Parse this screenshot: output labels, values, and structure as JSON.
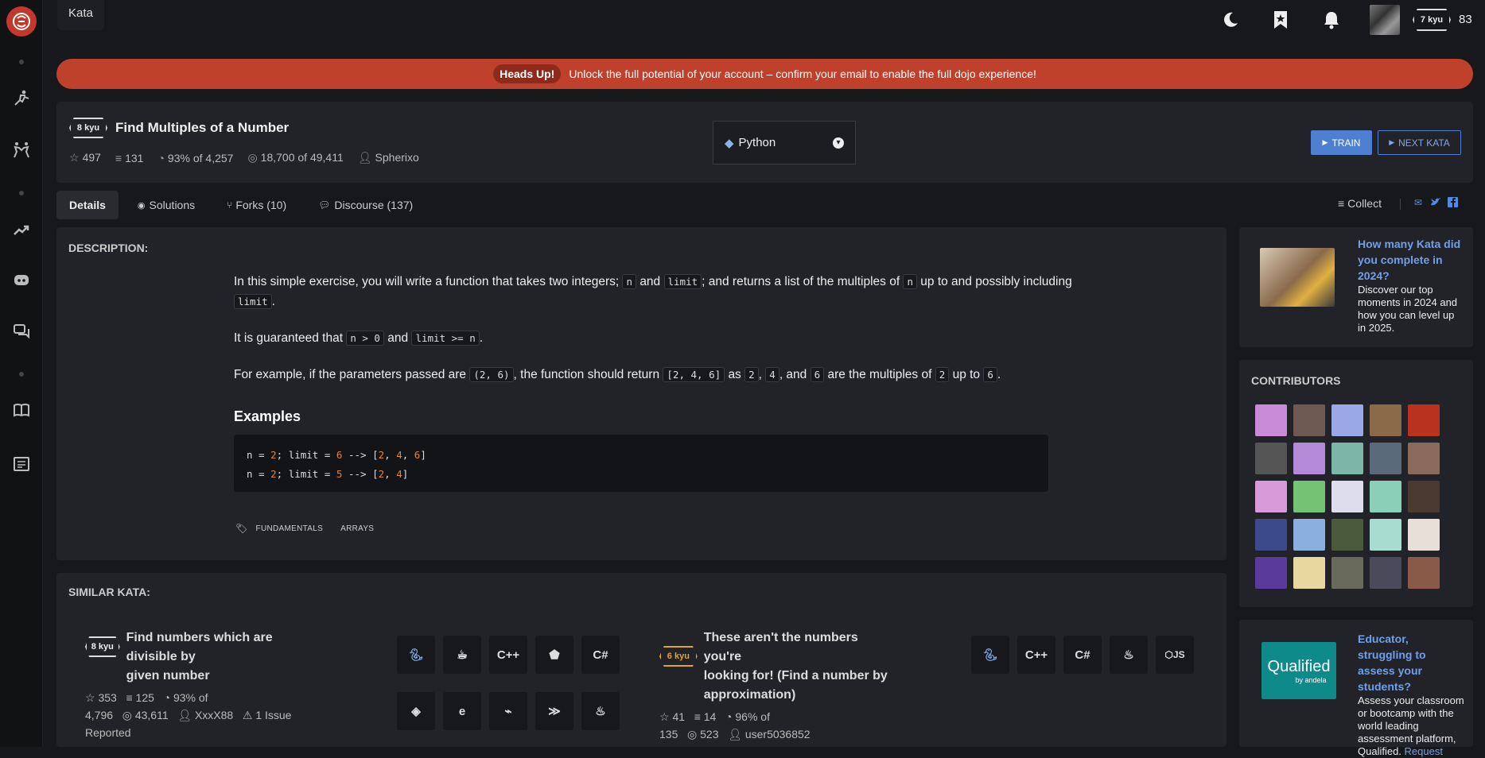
{
  "topbar": {
    "section_tab": "Kata",
    "rank_badge": "7 kyu",
    "honor": "83"
  },
  "banner": {
    "pill": "Heads Up!",
    "text": "Unlock the full potential of your account – confirm your email to enable the full dojo experience!"
  },
  "kata": {
    "kyu": "8 kyu",
    "title": "Find Multiples of a Number",
    "stars": "497",
    "collections": "131",
    "satisfaction": "93%",
    "satisfaction_of": "of 4,257",
    "completed": "18,700",
    "completed_of": "of 49,411",
    "author": "Spherixo",
    "language": "Python",
    "train_label": "TRAIN",
    "next_label": "NEXT KATA"
  },
  "tabs": [
    {
      "label": "Details"
    },
    {
      "label": "Solutions"
    },
    {
      "label": "Forks (10)"
    },
    {
      "label": "Discourse (137)"
    }
  ],
  "collect_label": "Collect",
  "description": {
    "heading": "DESCRIPTION:",
    "p1_a": "In this simple exercise, you will write a function that takes two integers;",
    "p1_n": "n",
    "p1_and": "and",
    "p1_limit": "limit",
    "p1_b": "; and returns a list of the multiples of",
    "p1_n2": "n",
    "p1_c": "up to and possibly",
    "p1_d": "including",
    "p1_limit2": "limit",
    "p1_e": ".",
    "p2_a": "It is guaranteed that",
    "p2_code1": "n > 0",
    "p2_and": "and",
    "p2_code2": "limit >= n",
    "p2_end": ".",
    "p3_a": "For example, if the parameters passed are",
    "p3_c1": "(2, 6)",
    "p3_b": ", the function should return",
    "p3_c2": "[2, 4, 6]",
    "p3_as": "as",
    "p3_c3": "2",
    "p3_comma": ",",
    "p3_c4": "4",
    "p3_and": ", and",
    "p3_c5": "6",
    "p3_d": "are the multiples of",
    "p3_c6": "2",
    "p3_upto": "up to",
    "p3_c7": "6",
    "p3_end": ".",
    "examples_heading": "Examples",
    "tags": [
      "FUNDAMENTALS",
      "ARRAYS"
    ]
  },
  "similar": {
    "heading": "SIMILAR KATA:",
    "items": [
      {
        "kyu": "8 kyu",
        "title_l1": "Find numbers which are divisible by",
        "title_l2": "given number",
        "stars": "353",
        "collections": "125",
        "satisfaction": "93% of",
        "satisfaction_of": "4,796",
        "completed": "43,611",
        "author": "XxxX88",
        "issues": "1 Issue Reported",
        "languages": [
          "python-icon",
          "coffeescript-icon",
          "cpp-icon",
          "crystal-icon",
          "csharp-icon",
          "elixir-icon",
          "erlang-icon",
          "dart-icon",
          "haskell-icon",
          "java-icon"
        ]
      },
      {
        "kyu": "6 kyu",
        "title_l1": "These aren't the numbers you're",
        "title_l2": "looking for! (Find a number by",
        "title_l3": "approximation)",
        "stars": "41",
        "collections": "14",
        "satisfaction": "96% of",
        "satisfaction_of": "135",
        "completed": "523",
        "author": "user5036852",
        "languages": [
          "python-icon",
          "cpp-icon",
          "csharp-icon",
          "java-icon",
          "javascript-icon"
        ]
      }
    ]
  },
  "promo1": {
    "title": "How many Kata did you complete in 2024?",
    "text": "Discover our top moments in 2024 and how you can level up in 2025."
  },
  "contributors_heading": "CONTRIBUTORS",
  "promo2": {
    "logo": "Qualified",
    "logo_sub": "by andela",
    "title": "Educator, struggling to assess your students?",
    "text": "Assess your classroom or bootcamp with the world leading assessment platform, Qualified.",
    "link": "Request"
  },
  "colors": {
    "accent_red": "#c0412b",
    "link_blue": "#4f7fd1",
    "kyu6_yellow": "#e0a42a"
  }
}
